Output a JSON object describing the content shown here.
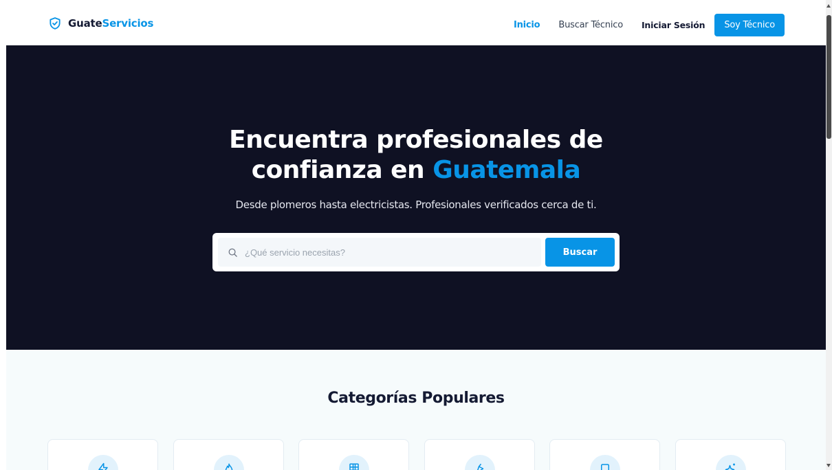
{
  "brand": {
    "name_part1": "Guate",
    "name_part2": "Servicios",
    "icon": "shield-check-icon"
  },
  "nav": {
    "links": [
      "Inicio",
      "Buscar Técnico",
      "Iniciar Sesión"
    ],
    "cta": "Soy Técnico"
  },
  "hero": {
    "title_line1": "Encuentra profesionales de",
    "title_line2_part1": "confianza en ",
    "title_line2_accent": "Guatemala",
    "subtitle": "Desde plomeros hasta electricistas. Profesionales verificados cerca de ti.",
    "search": {
      "placeholder": "¿Qué servicio necesitas?",
      "button": "Buscar",
      "icon": "search-icon"
    }
  },
  "categories": {
    "title": "Categorías Populares",
    "icons": [
      "lightning-icon",
      "flame-icon",
      "building-icon",
      "paint-icon",
      "monitor-icon",
      "sparkle-icon"
    ]
  },
  "colors": {
    "accent": "#0894e6",
    "hero_bg": "#0f1123",
    "section_bg": "#f6fbfc"
  }
}
